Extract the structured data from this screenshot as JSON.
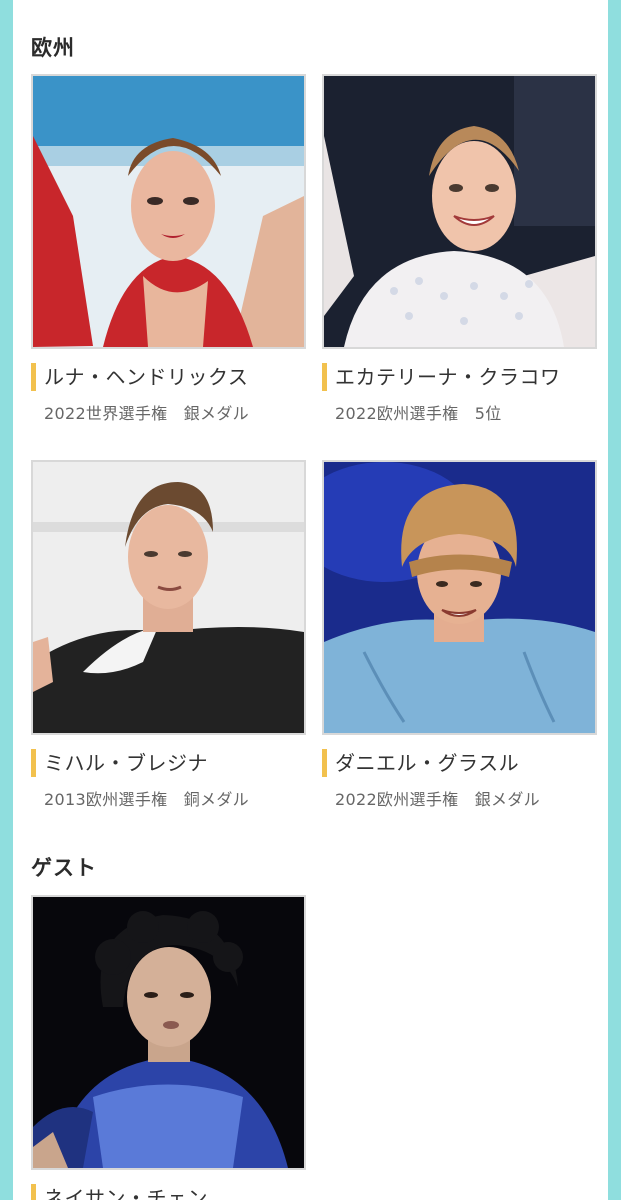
{
  "sections": [
    {
      "title": "欧州",
      "skaters": [
        {
          "name": "ルナ・ヘンドリックス",
          "achievement": "2022世界選手権　銀メダル"
        },
        {
          "name": "エカテリーナ・クラコワ",
          "achievement": "2022欧州選手権　5位"
        },
        {
          "name": "ミハル・ブレジナ",
          "achievement": "2013欧州選手権　銅メダル"
        },
        {
          "name": "ダニエル・グラスル",
          "achievement": "2022欧州選手権　銀メダル"
        }
      ]
    },
    {
      "title": "ゲスト",
      "skaters": [
        {
          "name": "ネイサン・チェン",
          "achievement": ""
        }
      ]
    }
  ],
  "colors": {
    "frame": "#8fdede",
    "accent_bar": "#f2c14e"
  }
}
